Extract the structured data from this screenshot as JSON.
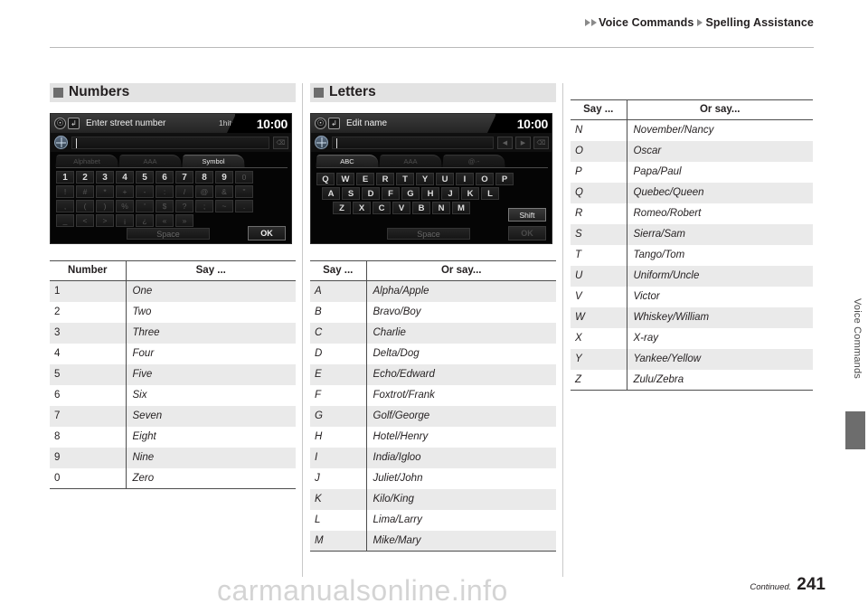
{
  "header": {
    "crumb1": "Voice Commands",
    "crumb2": "Spelling Assistance"
  },
  "sections": {
    "numbers": {
      "title": "Numbers"
    },
    "letters": {
      "title": "Letters"
    }
  },
  "nav_numbers": {
    "title": "Enter street number",
    "hits": "1hits",
    "clock": "10:00",
    "back_icon": "back-arrow-icon",
    "info_icon": "info-circle-icon",
    "globe_icon": "globe-icon",
    "delete_icon": "⌫",
    "tabs": [
      {
        "label": "Alphabet",
        "active": false
      },
      {
        "label": "AAA",
        "active": false
      },
      {
        "label": "Symbol",
        "active": true
      }
    ],
    "rows": [
      [
        "1",
        "2",
        "3",
        "4",
        "5",
        "6",
        "7",
        "8",
        "9",
        "0"
      ],
      [
        "!",
        "#",
        "*",
        "+",
        "-",
        ":",
        "/",
        "@",
        "&",
        "\""
      ],
      [
        ",",
        "(",
        ")",
        "%",
        "'",
        "$",
        "?",
        ";",
        "~",
        "."
      ],
      [
        "_",
        "<",
        ">",
        "¡",
        "¿",
        "«",
        "»"
      ]
    ],
    "space_label": "Space",
    "ok_label": "OK"
  },
  "nav_letters": {
    "title": "Edit name",
    "clock": "10:00",
    "globe_icon": "globe-icon",
    "left_arrow": "◀",
    "right_arrow": "▶",
    "delete_icon": "⌫",
    "tabs": [
      {
        "label": "ABC",
        "active": true
      },
      {
        "label": "AAA",
        "active": false
      },
      {
        "label": "@·-",
        "active": false
      }
    ],
    "rows": [
      [
        "Q",
        "W",
        "E",
        "R",
        "T",
        "Y",
        "U",
        "I",
        "O",
        "P"
      ],
      [
        "A",
        "S",
        "D",
        "F",
        "G",
        "H",
        "J",
        "K",
        "L"
      ],
      [
        "Z",
        "X",
        "C",
        "V",
        "B",
        "N",
        "M"
      ]
    ],
    "shift_label": "Shift",
    "space_label": "Space",
    "ok_label": "OK"
  },
  "numbers_table": {
    "headers": [
      "Number",
      "Say ..."
    ],
    "rows": [
      [
        "1",
        "One"
      ],
      [
        "2",
        "Two"
      ],
      [
        "3",
        "Three"
      ],
      [
        "4",
        "Four"
      ],
      [
        "5",
        "Five"
      ],
      [
        "6",
        "Six"
      ],
      [
        "7",
        "Seven"
      ],
      [
        "8",
        "Eight"
      ],
      [
        "9",
        "Nine"
      ],
      [
        "0",
        "Zero"
      ]
    ]
  },
  "letters_table_left": {
    "headers": [
      "Say ...",
      "Or say..."
    ],
    "rows": [
      [
        "A",
        "Alpha/Apple"
      ],
      [
        "B",
        "Bravo/Boy"
      ],
      [
        "C",
        "Charlie"
      ],
      [
        "D",
        "Delta/Dog"
      ],
      [
        "E",
        "Echo/Edward"
      ],
      [
        "F",
        "Foxtrot/Frank"
      ],
      [
        "G",
        "Golf/George"
      ],
      [
        "H",
        "Hotel/Henry"
      ],
      [
        "I",
        "India/Igloo"
      ],
      [
        "J",
        "Juliet/John"
      ],
      [
        "K",
        "Kilo/King"
      ],
      [
        "L",
        "Lima/Larry"
      ],
      [
        "M",
        "Mike/Mary"
      ]
    ]
  },
  "letters_table_right": {
    "headers": [
      "Say ...",
      "Or say..."
    ],
    "rows": [
      [
        "N",
        "November/Nancy"
      ],
      [
        "O",
        "Oscar"
      ],
      [
        "P",
        "Papa/Paul"
      ],
      [
        "Q",
        "Quebec/Queen"
      ],
      [
        "R",
        "Romeo/Robert"
      ],
      [
        "S",
        "Sierra/Sam"
      ],
      [
        "T",
        "Tango/Tom"
      ],
      [
        "U",
        "Uniform/Uncle"
      ],
      [
        "V",
        "Victor"
      ],
      [
        "W",
        "Whiskey/William"
      ],
      [
        "X",
        "X-ray"
      ],
      [
        "Y",
        "Yankee/Yellow"
      ],
      [
        "Z",
        "Zulu/Zebra"
      ]
    ]
  },
  "sidebar": {
    "label": "Voice Commands"
  },
  "footer": {
    "continued": "Continued.",
    "page": "241"
  },
  "watermark": {
    "text": "carmanualsonline.info"
  }
}
